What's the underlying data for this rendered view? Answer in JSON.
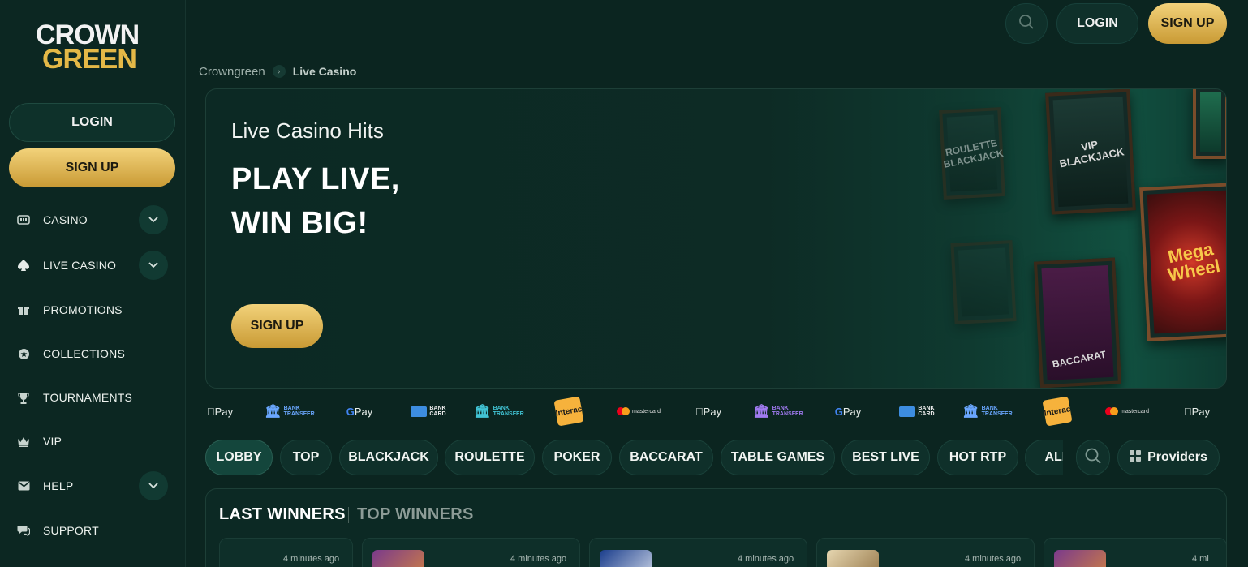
{
  "brand": {
    "logo_line1": "CROWN",
    "logo_line2": "GREEN",
    "gold": "#e4b847",
    "background": "#0b2520"
  },
  "sidebar": {
    "login_label": "LOGIN",
    "signup_label": "SIGN UP",
    "items": [
      {
        "label": "CASINO",
        "icon": "slot-machine-icon",
        "has_chevron": true
      },
      {
        "label": "LIVE CASINO",
        "icon": "spade-icon",
        "has_chevron": true
      },
      {
        "label": "PROMOTIONS",
        "icon": "gift-icon",
        "has_chevron": false
      },
      {
        "label": "COLLECTIONS",
        "icon": "collection-icon",
        "has_chevron": false
      },
      {
        "label": "TOURNAMENTS",
        "icon": "trophy-icon",
        "has_chevron": false
      },
      {
        "label": "VIP",
        "icon": "crown-icon",
        "has_chevron": false
      },
      {
        "label": "HELP",
        "icon": "mail-icon",
        "has_chevron": true
      },
      {
        "label": "SUPPORT",
        "icon": "chat-icon",
        "has_chevron": false
      }
    ]
  },
  "header": {
    "login_label": "LOGIN",
    "signup_label": "SIGN UP"
  },
  "breadcrumb": {
    "home": "Crowngreen",
    "separator": "›",
    "current": "Live Casino"
  },
  "hero": {
    "subtitle": "Live Casino Hits",
    "title_line1": "PLAY LIVE,",
    "title_line2": "WIN BIG!",
    "signup_label": "SIGN UP",
    "frames": {
      "blackjack": "VIP BLACKJACK",
      "roulette_blackjack": "ROULETTE BLACKJACK",
      "baccarat": "BACCARAT",
      "mega_line1": "Mega",
      "mega_line2": "Wheel"
    }
  },
  "payments": {
    "apple_pay": "Pay",
    "google_pay": "Pay",
    "bank_transfer_line1": "BANK",
    "bank_transfer_line2": "TRANSFER",
    "bank_card_line1": "BANK",
    "bank_card_line2": "CARD",
    "interac": "Interac",
    "mastercard": "mastercard"
  },
  "tabs": [
    {
      "label": "LOBBY",
      "active": true
    },
    {
      "label": "TOP",
      "active": false
    },
    {
      "label": "BLACKJACK",
      "active": false
    },
    {
      "label": "ROULETTE",
      "active": false
    },
    {
      "label": "POKER",
      "active": false
    },
    {
      "label": "BACCARAT",
      "active": false
    },
    {
      "label": "TABLE GAMES",
      "active": false
    },
    {
      "label": "BEST LIVE",
      "active": false
    },
    {
      "label": "HOT RTP",
      "active": false
    },
    {
      "label": "ALL",
      "active": false
    }
  ],
  "providers_label": "Providers",
  "winners": {
    "tab_last": "LAST WINNERS",
    "tab_top": "TOP WINNERS",
    "cards": [
      {
        "time": "4 minutes ago"
      },
      {
        "time": "4 minutes ago"
      },
      {
        "time": "4 minutes ago"
      },
      {
        "time": "4 minutes ago"
      },
      {
        "time": "4 mi"
      }
    ]
  }
}
